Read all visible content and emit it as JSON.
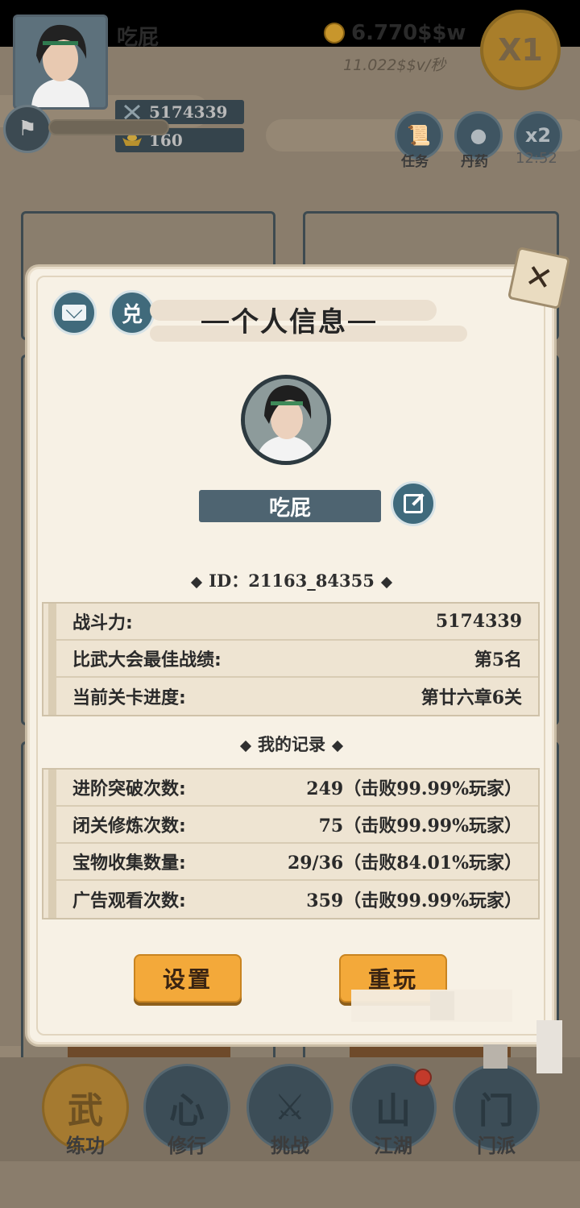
{
  "hud": {
    "player_name": "吃屁",
    "power": "5174339",
    "gold_ingots": "160",
    "coins": "6.770$$w",
    "coin_rate": "11.022$$v/秒",
    "speed_multiplier": "X1",
    "buttons": [
      {
        "icon": "scroll-icon",
        "label": "任务"
      },
      {
        "icon": "pill-icon",
        "label": "丹药"
      },
      {
        "icon": "x2-icon",
        "label": "x2"
      }
    ],
    "timer": "12:52"
  },
  "bottom_nav": [
    {
      "icon": "martial-icon",
      "glyph": "武",
      "label": "练功",
      "active": true
    },
    {
      "icon": "heart-icon",
      "glyph": "心",
      "label": "修行",
      "active": false
    },
    {
      "icon": "swords-icon",
      "glyph": "⚔",
      "label": "挑战",
      "active": false
    },
    {
      "icon": "mountain-icon",
      "glyph": "山",
      "label": "江湖",
      "active": false,
      "badge": true
    },
    {
      "icon": "gate-icon",
      "glyph": "门",
      "label": "门派",
      "active": false
    }
  ],
  "panel": {
    "title": "个人信息",
    "redeem_label": "兑",
    "player_name": "吃屁",
    "id_text": "ID：21163_84355",
    "stats": [
      {
        "label": "战斗力:",
        "value": "5174339"
      },
      {
        "label": "比武大会最佳战绩:",
        "value": "第5名"
      },
      {
        "label": "当前关卡进度:",
        "value": "第廿六章6关"
      }
    ],
    "records_title": "我的记录",
    "records": [
      {
        "label": "进阶突破次数:",
        "value": "249（击败99.99%玩家）"
      },
      {
        "label": "闭关修炼次数:",
        "value": "75（击败99.99%玩家）"
      },
      {
        "label": "宝物收集数量:",
        "value": "29/36（击败84.01%玩家）"
      },
      {
        "label": "广告观看次数:",
        "value": "359（击败99.99%玩家）"
      }
    ],
    "settings_label": "设置",
    "replay_label": "重玩"
  },
  "colors": {
    "panel_bg": "#f7f1e5",
    "accent_button": "#f3a93a",
    "name_bar": "#4e6471",
    "icon_button": "#3f6a7c"
  }
}
